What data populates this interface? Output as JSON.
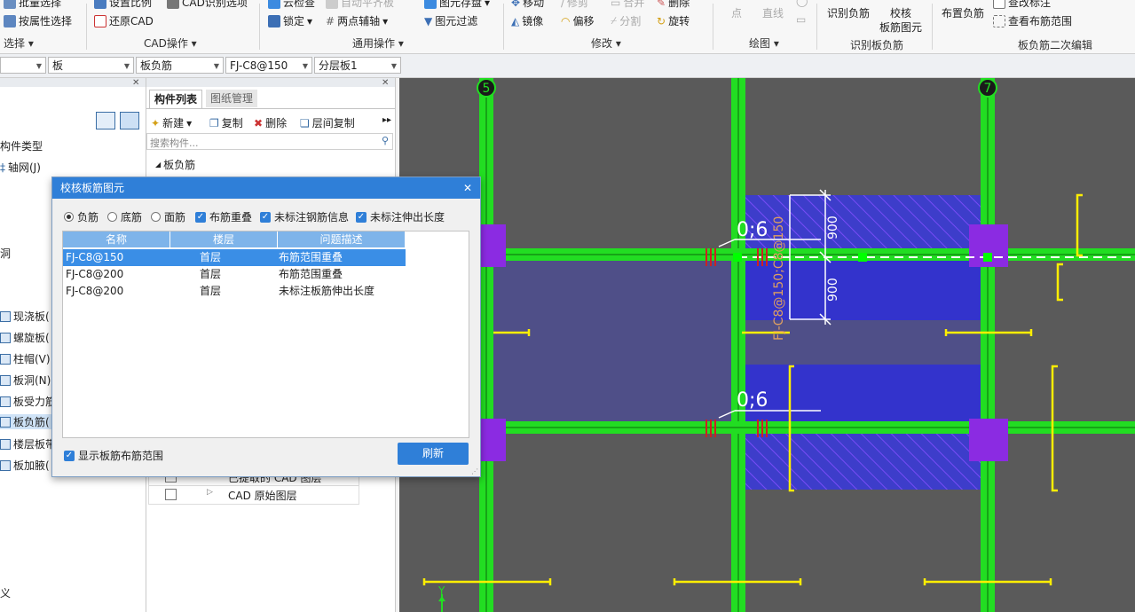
{
  "ribbon": {
    "groups": {
      "select": "选择",
      "cad_ops": "CAD操作",
      "common_ops": "通用操作",
      "modify": "修改",
      "draw": "绘图",
      "identify_slab_rebar": "识别板负筋",
      "slab_neg_rebar_edit": "板负筋二次编辑"
    },
    "items": {
      "batch_select": "批量选择",
      "select_by_attr": "按属性选择",
      "set_scale": "设置比例",
      "restore_cad": "还原CAD",
      "cad_identify_options": "CAD识别选项",
      "cloud_check": "云检查",
      "lock": "锁定",
      "two_point_aux": "两点辅轴",
      "auto_level_slab": "自动平齐板",
      "element_storage": "图元存盘",
      "element_filter": "图元过滤",
      "move": "移动",
      "trim": "修剪",
      "merge": "合并",
      "delete": "删除",
      "mirror": "镜像",
      "offset": "偏移",
      "split": "分割",
      "rotate": "旋转",
      "point": "点",
      "line": "直线",
      "identify_neg_rebar": "识别负筋",
      "verify_line1": "校核",
      "verify_line2": "板筋图元",
      "place_neg_rebar": "布置负筋",
      "check_label": "查改标注",
      "view_rebar_range": "查看布筋范围"
    }
  },
  "selector_bar": {
    "c1": "",
    "c2": "板",
    "c3": "板负筋",
    "c4": "FJ-C8@150",
    "c5": "分层板1"
  },
  "left_panel": {
    "header": "构件类型",
    "axis_net": "轴网(J)",
    "hole": "洞",
    "items": [
      "现浇板(",
      "螺旋板(",
      "柱帽(V)",
      "板洞(N)",
      "板受力筋",
      "板负筋(",
      "楼层板带",
      "板加腋("
    ],
    "bottom": "义"
  },
  "mid_panel": {
    "tab_list": "构件列表",
    "tab_drawing": "图纸管理",
    "new": "新建",
    "copy": "复制",
    "delete": "删除",
    "floor_copy": "层间复制",
    "search_placeholder": "搜索构件...",
    "tree_root": "板负筋",
    "layer_row1": "已提取的 CAD 图层",
    "layer_row2": "CAD 原始图层"
  },
  "dialog": {
    "title": "校核板筋图元",
    "radio_neg": "负筋",
    "radio_bottom": "底筋",
    "radio_top": "面筋",
    "chk_overlap": "布筋重叠",
    "chk_no_info": "未标注钢筋信息",
    "chk_no_ext": "未标注伸出长度",
    "col_name": "名称",
    "col_floor": "楼层",
    "col_desc": "问题描述",
    "rows": [
      {
        "name": "FJ-C8@150",
        "floor": "首层",
        "desc": "布筋范围重叠"
      },
      {
        "name": "FJ-C8@200",
        "floor": "首层",
        "desc": "布筋范围重叠"
      },
      {
        "name": "FJ-C8@200",
        "floor": "首层",
        "desc": "未标注板筋伸出长度"
      }
    ],
    "show_range": "显示板筋布筋范围",
    "refresh": "刷新"
  },
  "canvas": {
    "axis5": "5",
    "axis7": "7",
    "dim_top": "900",
    "dim_bottom": "900",
    "label1": "0;6",
    "label2": "0;6",
    "rebar_label": "FJ-C8@150;C8@150",
    "y_axis": "Y"
  },
  "colors": {
    "accent": "#2f7fd8",
    "beam": "#22dd22",
    "rebar_fill": "#3333cc",
    "column": "#8b2be2",
    "dim": "#ffee00"
  }
}
